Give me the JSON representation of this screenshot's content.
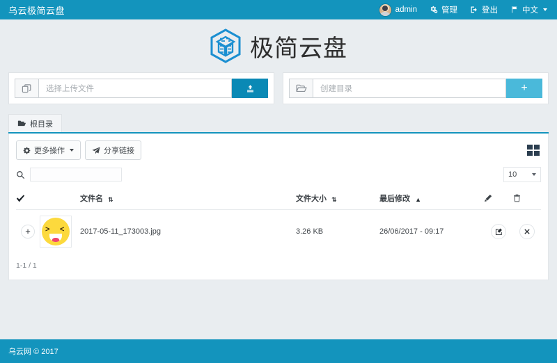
{
  "topbar": {
    "brand": "乌云极简云盘",
    "user": "admin",
    "manage": "管理",
    "logout": "登出",
    "language": "中文",
    "bg_color": "#1394bd"
  },
  "logo": {
    "title": "极简云盘",
    "icon_color": "#1b8fd1"
  },
  "upload": {
    "file_placeholder": "选择上传文件",
    "upload_button_label": "",
    "upload_button_color": "#0a89b5",
    "folder_placeholder": "创建目录",
    "create_button_label": "+",
    "create_button_color": "#4ab9da"
  },
  "breadcrumb": {
    "tab_label": "根目录",
    "underline_color": "#1394bd"
  },
  "toolbar": {
    "more_actions": "更多操作",
    "share_link": "分享链接",
    "grid_view_title": ""
  },
  "filters": {
    "search_value": "",
    "page_size": "10"
  },
  "table": {
    "headers": {
      "check": "",
      "name": "文件名",
      "size": "文件大小",
      "modified": "最后修改",
      "edit": "",
      "delete": ""
    },
    "sort": {
      "name": "both",
      "size": "both",
      "modified": "asc"
    },
    "rows": [
      {
        "expand": "+",
        "thumb": "emoji-laughing-thumbnail",
        "name": "2017-05-11_173003.jpg",
        "size": "3.26 KB",
        "modified": "26/06/2017 - 09:17"
      }
    ]
  },
  "pagination": {
    "info": "1-1 / 1"
  },
  "footer": {
    "text": "乌云网 © 2017"
  }
}
